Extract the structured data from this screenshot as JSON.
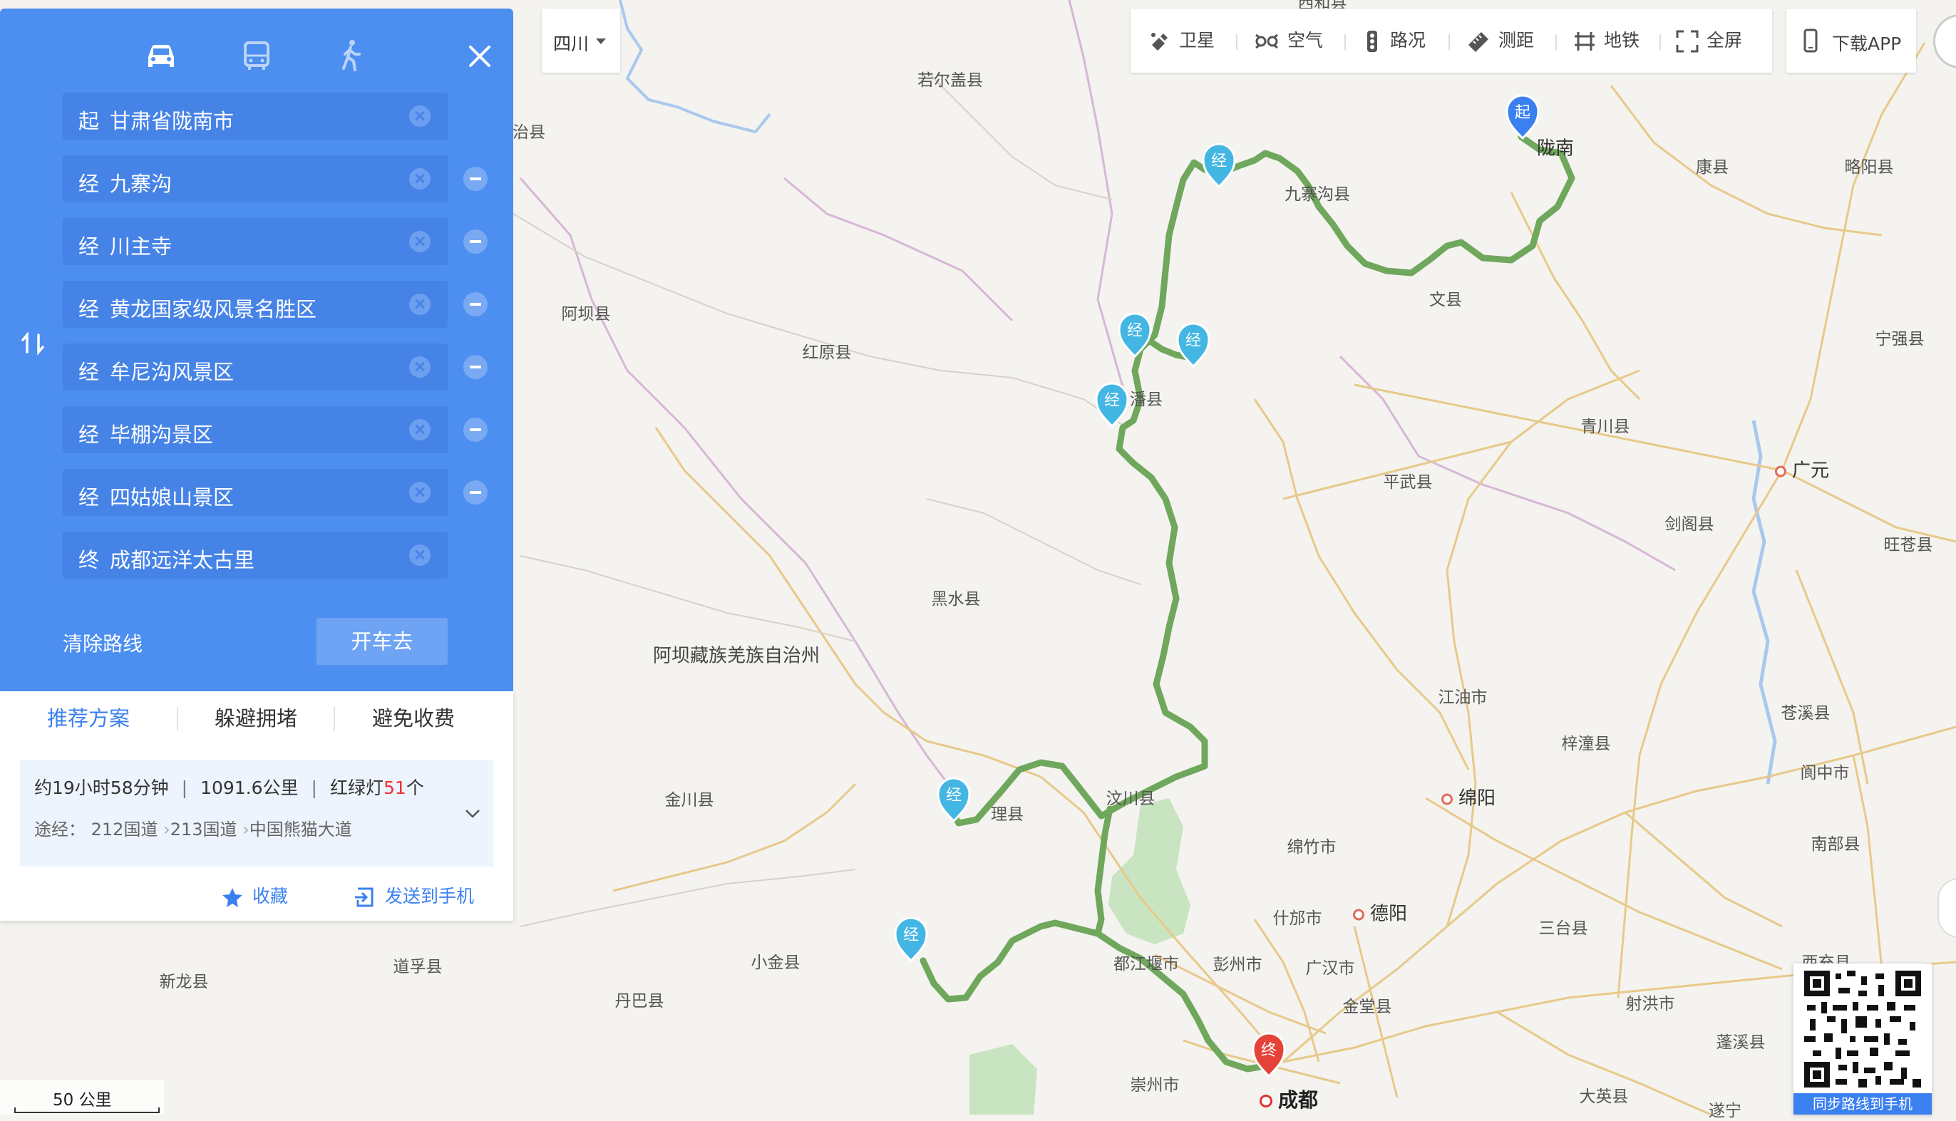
{
  "transport_modes": [
    {
      "name": "car-icon",
      "active": true
    },
    {
      "name": "bus-icon",
      "active": false
    },
    {
      "name": "walk-icon",
      "active": false
    }
  ],
  "stops": [
    {
      "tag": "起",
      "name": "甘肃省陇南市",
      "removable": false
    },
    {
      "tag": "经",
      "name": "九寨沟",
      "removable": true
    },
    {
      "tag": "经",
      "name": "川主寺",
      "removable": true
    },
    {
      "tag": "经",
      "name": "黄龙国家级风景名胜区",
      "removable": true
    },
    {
      "tag": "经",
      "name": "牟尼沟风景区",
      "removable": true
    },
    {
      "tag": "经",
      "name": "毕棚沟景区",
      "removable": true
    },
    {
      "tag": "经",
      "name": "四姑娘山景区",
      "removable": true
    },
    {
      "tag": "终",
      "name": "成都远洋太古里",
      "removable": false
    }
  ],
  "actions": {
    "clear_route": "清除路线",
    "drive": "开车去"
  },
  "route_tabs": [
    "推荐方案",
    "躲避拥堵",
    "避免收费"
  ],
  "route_summary": {
    "duration": "约19小时58分钟",
    "distance": "1091.6公里",
    "lights_label": "红绿灯",
    "lights_count": "51",
    "lights_unit": "个",
    "via_label": "途经：",
    "via": [
      "212国道",
      "213国道",
      "中国熊猫大道"
    ]
  },
  "result_actions": {
    "favorite": "收藏",
    "send": "发送到手机"
  },
  "region": "四川",
  "toolbar": [
    {
      "icon": "satellite-icon",
      "label": "卫星"
    },
    {
      "icon": "air-icon",
      "label": "空气"
    },
    {
      "icon": "traffic-icon",
      "label": "路况"
    },
    {
      "icon": "ruler-icon",
      "label": "测距"
    },
    {
      "icon": "metro-icon",
      "label": "地铁"
    },
    {
      "icon": "fullscreen-icon",
      "label": "全屏"
    }
  ],
  "download_app": "下载APP",
  "qr_caption": "同步路线到手机",
  "scale": "50 公里",
  "markers": {
    "start": "起",
    "via": "经",
    "end": "终"
  },
  "places": {
    "counties": [
      "若尔盖县",
      "治县",
      "阿坝县",
      "红原县",
      "黑水县",
      "金川县",
      "小金县",
      "丹巴县",
      "道孚县",
      "新龙县",
      "九寨沟县",
      "文县",
      "潘县",
      "平武县",
      "青川县",
      "剑阁县",
      "康县",
      "略阳县",
      "宁强县",
      "旺苍县",
      "苍溪县",
      "梓潼县",
      "阆中市",
      "南部县",
      "江油市",
      "绵竹市",
      "什邡市",
      "彭州市",
      "广汉市",
      "金堂县",
      "三台县",
      "射洪市",
      "蓬溪县",
      "西充县",
      "大英县",
      "遂宁",
      "理县",
      "汶川县",
      "都江堰市",
      "崇州市"
    ],
    "cities": [
      "广元",
      "绵阳",
      "德阳"
    ],
    "towns": [
      "陇南"
    ],
    "capital": "成都",
    "prefecture": "阿坝藏族羌族自治州",
    "top_edge": "西和县"
  }
}
